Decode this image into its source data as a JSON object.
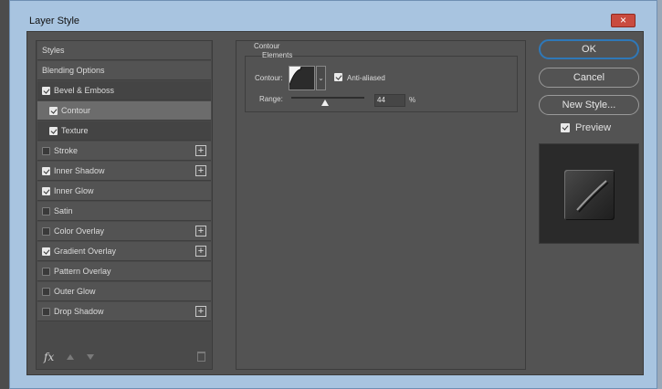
{
  "window": {
    "title": "Layer Style",
    "close_label": "×"
  },
  "styles_list": {
    "items": [
      {
        "label": "Styles",
        "checkbox": false,
        "checked": false,
        "plus": false
      },
      {
        "label": "Blending Options",
        "checkbox": false,
        "checked": false,
        "plus": false
      },
      {
        "label": "Bevel & Emboss",
        "checkbox": true,
        "checked": true,
        "plus": false
      },
      {
        "label": "Contour",
        "checkbox": true,
        "checked": true,
        "plus": false,
        "selected": true
      },
      {
        "label": "Texture",
        "checkbox": true,
        "checked": true,
        "plus": false
      },
      {
        "label": "Stroke",
        "checkbox": true,
        "checked": false,
        "plus": true
      },
      {
        "label": "Inner Shadow",
        "checkbox": true,
        "checked": true,
        "plus": true
      },
      {
        "label": "Inner Glow",
        "checkbox": true,
        "checked": true,
        "plus": false
      },
      {
        "label": "Satin",
        "checkbox": true,
        "checked": false,
        "plus": false
      },
      {
        "label": "Color Overlay",
        "checkbox": true,
        "checked": false,
        "plus": true
      },
      {
        "label": "Gradient Overlay",
        "checkbox": true,
        "checked": true,
        "plus": true
      },
      {
        "label": "Pattern Overlay",
        "checkbox": true,
        "checked": false,
        "plus": false
      },
      {
        "label": "Outer Glow",
        "checkbox": true,
        "checked": false,
        "plus": false
      },
      {
        "label": "Drop Shadow",
        "checkbox": true,
        "checked": false,
        "plus": true
      }
    ],
    "footer": {
      "fx_label": "fx"
    }
  },
  "contour_panel": {
    "section_title": "Contour",
    "group_title": "Elements",
    "contour_label": "Contour:",
    "anti_aliased_label": "Anti-aliased",
    "anti_aliased_checked": true,
    "range_label": "Range:",
    "range_value": "44",
    "range_unit": "%",
    "range_fraction": 0.44
  },
  "buttons": {
    "ok": "OK",
    "cancel": "Cancel",
    "new_style": "New Style...",
    "preview_label": "Preview",
    "preview_checked": true
  },
  "colors": {
    "accent": "#2f78b8",
    "panel": "#535353",
    "close": "#c94b3f"
  }
}
